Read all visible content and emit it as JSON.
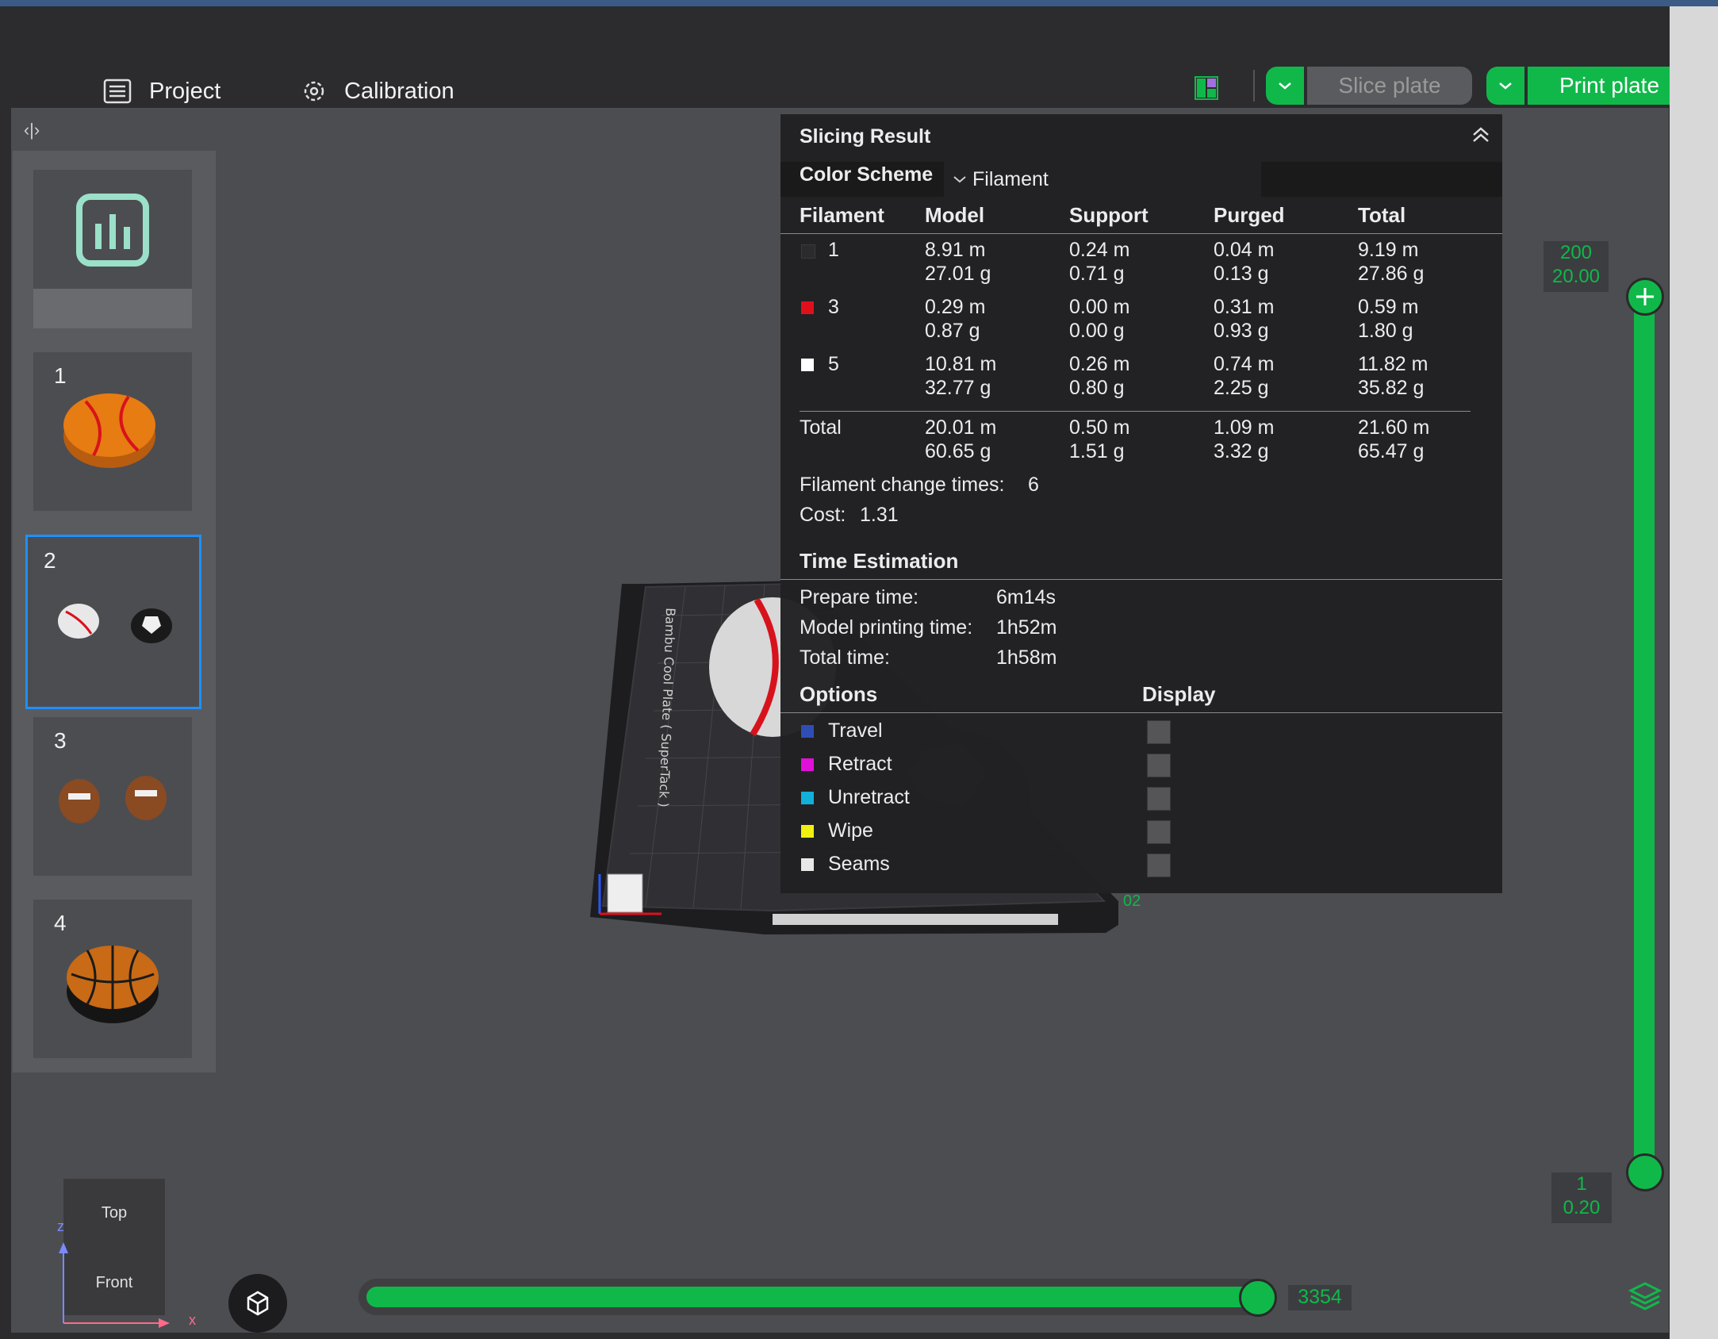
{
  "toolbar": {
    "project_label": "Project",
    "calibration_label": "Calibration",
    "slice_label": "Slice plate",
    "print_label": "Print plate"
  },
  "plates": [
    {
      "number": "",
      "content": "stats"
    },
    {
      "number": "1",
      "content": "baseball"
    },
    {
      "number": "2",
      "content": "baseball-soccer"
    },
    {
      "number": "3",
      "content": "footballs"
    },
    {
      "number": "4",
      "content": "basketball"
    }
  ],
  "slicing": {
    "title": "Slicing Result",
    "color_scheme_label": "Color Scheme",
    "color_scheme_value": "Filament",
    "headers": [
      "Filament",
      "Model",
      "Support",
      "Purged",
      "Total"
    ],
    "rows": [
      {
        "id": "1",
        "color": "#2b2b2b",
        "model": [
          "8.91 m",
          "27.01 g"
        ],
        "support": [
          "0.24 m",
          "0.71 g"
        ],
        "purged": [
          "0.04 m",
          "0.13 g"
        ],
        "total": [
          "9.19 m",
          "27.86 g"
        ]
      },
      {
        "id": "3",
        "color": "#e0101a",
        "model": [
          "0.29 m",
          "0.87 g"
        ],
        "support": [
          "0.00 m",
          "0.00 g"
        ],
        "purged": [
          "0.31 m",
          "0.93 g"
        ],
        "total": [
          "0.59 m",
          "1.80 g"
        ]
      },
      {
        "id": "5",
        "color": "#ffffff",
        "model": [
          "10.81 m",
          "32.77 g"
        ],
        "support": [
          "0.26 m",
          "0.80 g"
        ],
        "purged": [
          "0.74 m",
          "2.25 g"
        ],
        "total": [
          "11.82 m",
          "35.82 g"
        ]
      }
    ],
    "total_row": {
      "label": "Total",
      "model": [
        "20.01 m",
        "60.65 g"
      ],
      "support": [
        "0.50 m",
        "1.51 g"
      ],
      "purged": [
        "1.09 m",
        "3.32 g"
      ],
      "total": [
        "21.60 m",
        "65.47 g"
      ]
    },
    "filament_change_label": "Filament change times:",
    "filament_change_value": "6",
    "cost_label": "Cost:",
    "cost_value": "1.31"
  },
  "time_estimation": {
    "title": "Time Estimation",
    "prepare_label": "Prepare time:",
    "prepare_value": "6m14s",
    "model_label": "Model printing time:",
    "model_value": "1h52m",
    "total_label": "Total time:",
    "total_value": "1h58m"
  },
  "options": {
    "title": "Options",
    "display_title": "Display",
    "items": [
      {
        "label": "Travel",
        "color": "#2f4db5"
      },
      {
        "label": "Retract",
        "color": "#e010d8"
      },
      {
        "label": "Unretract",
        "color": "#10b0d8"
      },
      {
        "label": "Wipe",
        "color": "#f0f010"
      },
      {
        "label": "Seams",
        "color": "#e8e8e8"
      }
    ]
  },
  "layer_slider": {
    "top_layer": "200",
    "top_height": "20.00",
    "bottom_layer": "1",
    "bottom_height": "0.20"
  },
  "move_slider": {
    "value": "3354"
  },
  "view_cube": {
    "top_label": "Top",
    "front_label": "Front",
    "z_label": "z",
    "x_label": "x"
  },
  "plate_label": "02"
}
